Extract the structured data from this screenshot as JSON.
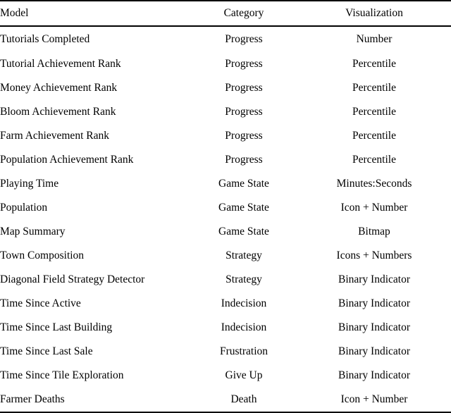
{
  "table": {
    "caption_visible": false,
    "columns": [
      {
        "key": "model",
        "label": "Model",
        "align": "left"
      },
      {
        "key": "category",
        "label": "Category",
        "align": "center"
      },
      {
        "key": "visualization",
        "label": "Visualization",
        "align": "center"
      }
    ],
    "header": {
      "model": "Model",
      "category": "Category",
      "visualization": "Visualization"
    },
    "rows": [
      {
        "model": "Tutorials Completed",
        "category": "Progress",
        "visualization": "Number"
      },
      {
        "model": "Tutorial Achievement Rank",
        "category": "Progress",
        "visualization": "Percentile"
      },
      {
        "model": "Money Achievement Rank",
        "category": "Progress",
        "visualization": "Percentile"
      },
      {
        "model": "Bloom Achievement Rank",
        "category": "Progress",
        "visualization": "Percentile"
      },
      {
        "model": "Farm Achievement Rank",
        "category": "Progress",
        "visualization": "Percentile"
      },
      {
        "model": "Population Achievement Rank",
        "category": "Progress",
        "visualization": "Percentile"
      },
      {
        "model": "Playing Time",
        "category": "Game State",
        "visualization": "Minutes:Seconds"
      },
      {
        "model": "Population",
        "category": "Game State",
        "visualization": "Icon + Number"
      },
      {
        "model": "Map Summary",
        "category": "Game State",
        "visualization": "Bitmap"
      },
      {
        "model": "Town Composition",
        "category": "Strategy",
        "visualization": "Icons + Numbers"
      },
      {
        "model": "Diagonal Field Strategy Detector",
        "category": "Strategy",
        "visualization": "Binary Indicator"
      },
      {
        "model": "Time Since Active",
        "category": "Indecision",
        "visualization": "Binary Indicator"
      },
      {
        "model": "Time Since Last Building",
        "category": "Indecision",
        "visualization": "Binary Indicator"
      },
      {
        "model": "Time Since Last Sale",
        "category": "Frustration",
        "visualization": "Binary Indicator"
      },
      {
        "model": "Time Since Tile Exploration",
        "category": "Give Up",
        "visualization": "Binary Indicator"
      },
      {
        "model": "Farmer Deaths",
        "category": "Death",
        "visualization": "Icon + Number"
      }
    ]
  },
  "style": {
    "text_color": "#000000",
    "background_color": "#ffffff",
    "rule_color": "#000000"
  }
}
